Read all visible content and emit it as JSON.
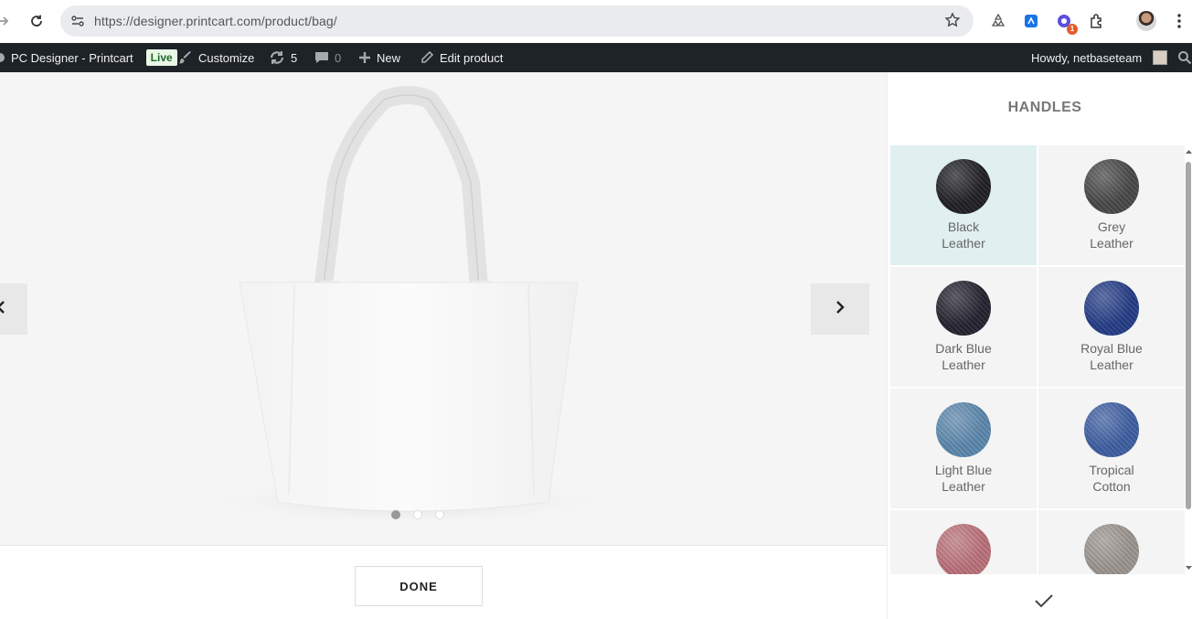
{
  "browser": {
    "url": "https://designer.printcart.com/product/bag/",
    "extension_badge": "1"
  },
  "adminbar": {
    "site_name": "PC Designer - Printcart",
    "live_label": "Live",
    "customize_label": "Customize",
    "updates_count": "5",
    "comments_count": "0",
    "new_label": "New",
    "edit_label": "Edit product",
    "howdy_label": "Howdy, netbaseteam"
  },
  "stage": {
    "done_label": "DONE",
    "slides_total": 3,
    "active_slide": 1
  },
  "panel": {
    "title": "HANDLES",
    "swatches": [
      {
        "label": "Black\nLeather",
        "color": "#1f1e22",
        "selected": true
      },
      {
        "label": "Grey\nLeather",
        "color": "#474747",
        "selected": false
      },
      {
        "label": "Dark Blue\nLeather",
        "color": "#23222f",
        "selected": false
      },
      {
        "label": "Royal Blue\nLeather",
        "color": "#243c85",
        "selected": false
      },
      {
        "label": "Light Blue\nLeather",
        "color": "#5b86ab",
        "selected": false
      },
      {
        "label": "Tropical\nCotton",
        "color": "#3d5ea0",
        "selected": false
      },
      {
        "label": "",
        "color": "#b9707a",
        "selected": false
      },
      {
        "label": "",
        "color": "#9a938e",
        "selected": false
      }
    ]
  }
}
